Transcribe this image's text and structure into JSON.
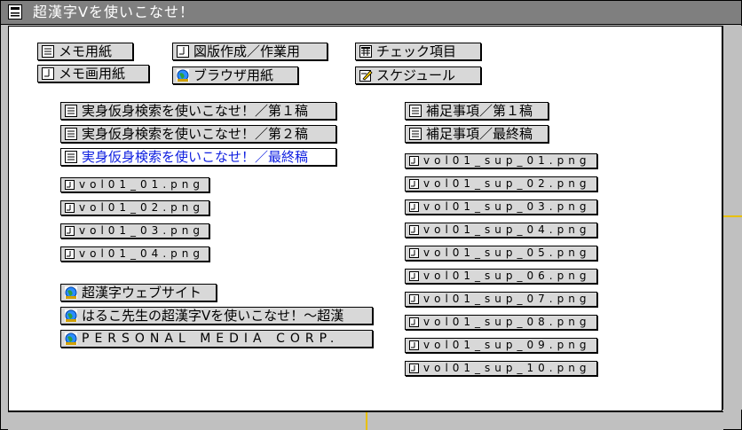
{
  "window": {
    "title": "超漢字Ⅴを使いこなせ！"
  },
  "row1": [
    {
      "label": "メモ用紙",
      "icon": "text-doc-icon"
    },
    {
      "label": "メモ画用紙",
      "icon": "figure-doc-icon"
    },
    {
      "label": "図版作成／作業用",
      "icon": "figure-doc-icon"
    },
    {
      "label": "ブラウザ用紙",
      "icon": "globe-icon"
    },
    {
      "label": "チェック項目",
      "icon": "table-icon"
    },
    {
      "label": "スケジュール",
      "icon": "schedule-icon"
    }
  ],
  "left_docs": [
    {
      "label": "実身仮身検索を使いこなせ！／第１稿"
    },
    {
      "label": "実身仮身検索を使いこなせ！／第２稿"
    },
    {
      "label": "実身仮身検索を使いこなせ！／最終稿"
    }
  ],
  "left_images": [
    "vol01_01.png",
    "vol01_02.png",
    "vol01_03.png",
    "vol01_04.png"
  ],
  "links": [
    {
      "label": "超漢字ウェブサイト"
    },
    {
      "label": "はるこ先生の超漢字Ⅴを使いこなせ！～超漢"
    },
    {
      "label": "PERSONAL MEDIA CORP."
    }
  ],
  "right_docs": [
    {
      "label": "補足事項／第１稿"
    },
    {
      "label": "補足事項／最終稿"
    }
  ],
  "right_images": [
    "vol01_sup_01.png",
    "vol01_sup_02.png",
    "vol01_sup_03.png",
    "vol01_sup_04.png",
    "vol01_sup_05.png",
    "vol01_sup_06.png",
    "vol01_sup_07.png",
    "vol01_sup_08.png",
    "vol01_sup_09.png",
    "vol01_sup_10.png"
  ],
  "colors": {
    "selected_text": "#1020e0",
    "titlebar": "#7f7f7f",
    "scroll_thumb": "#e8c000"
  }
}
